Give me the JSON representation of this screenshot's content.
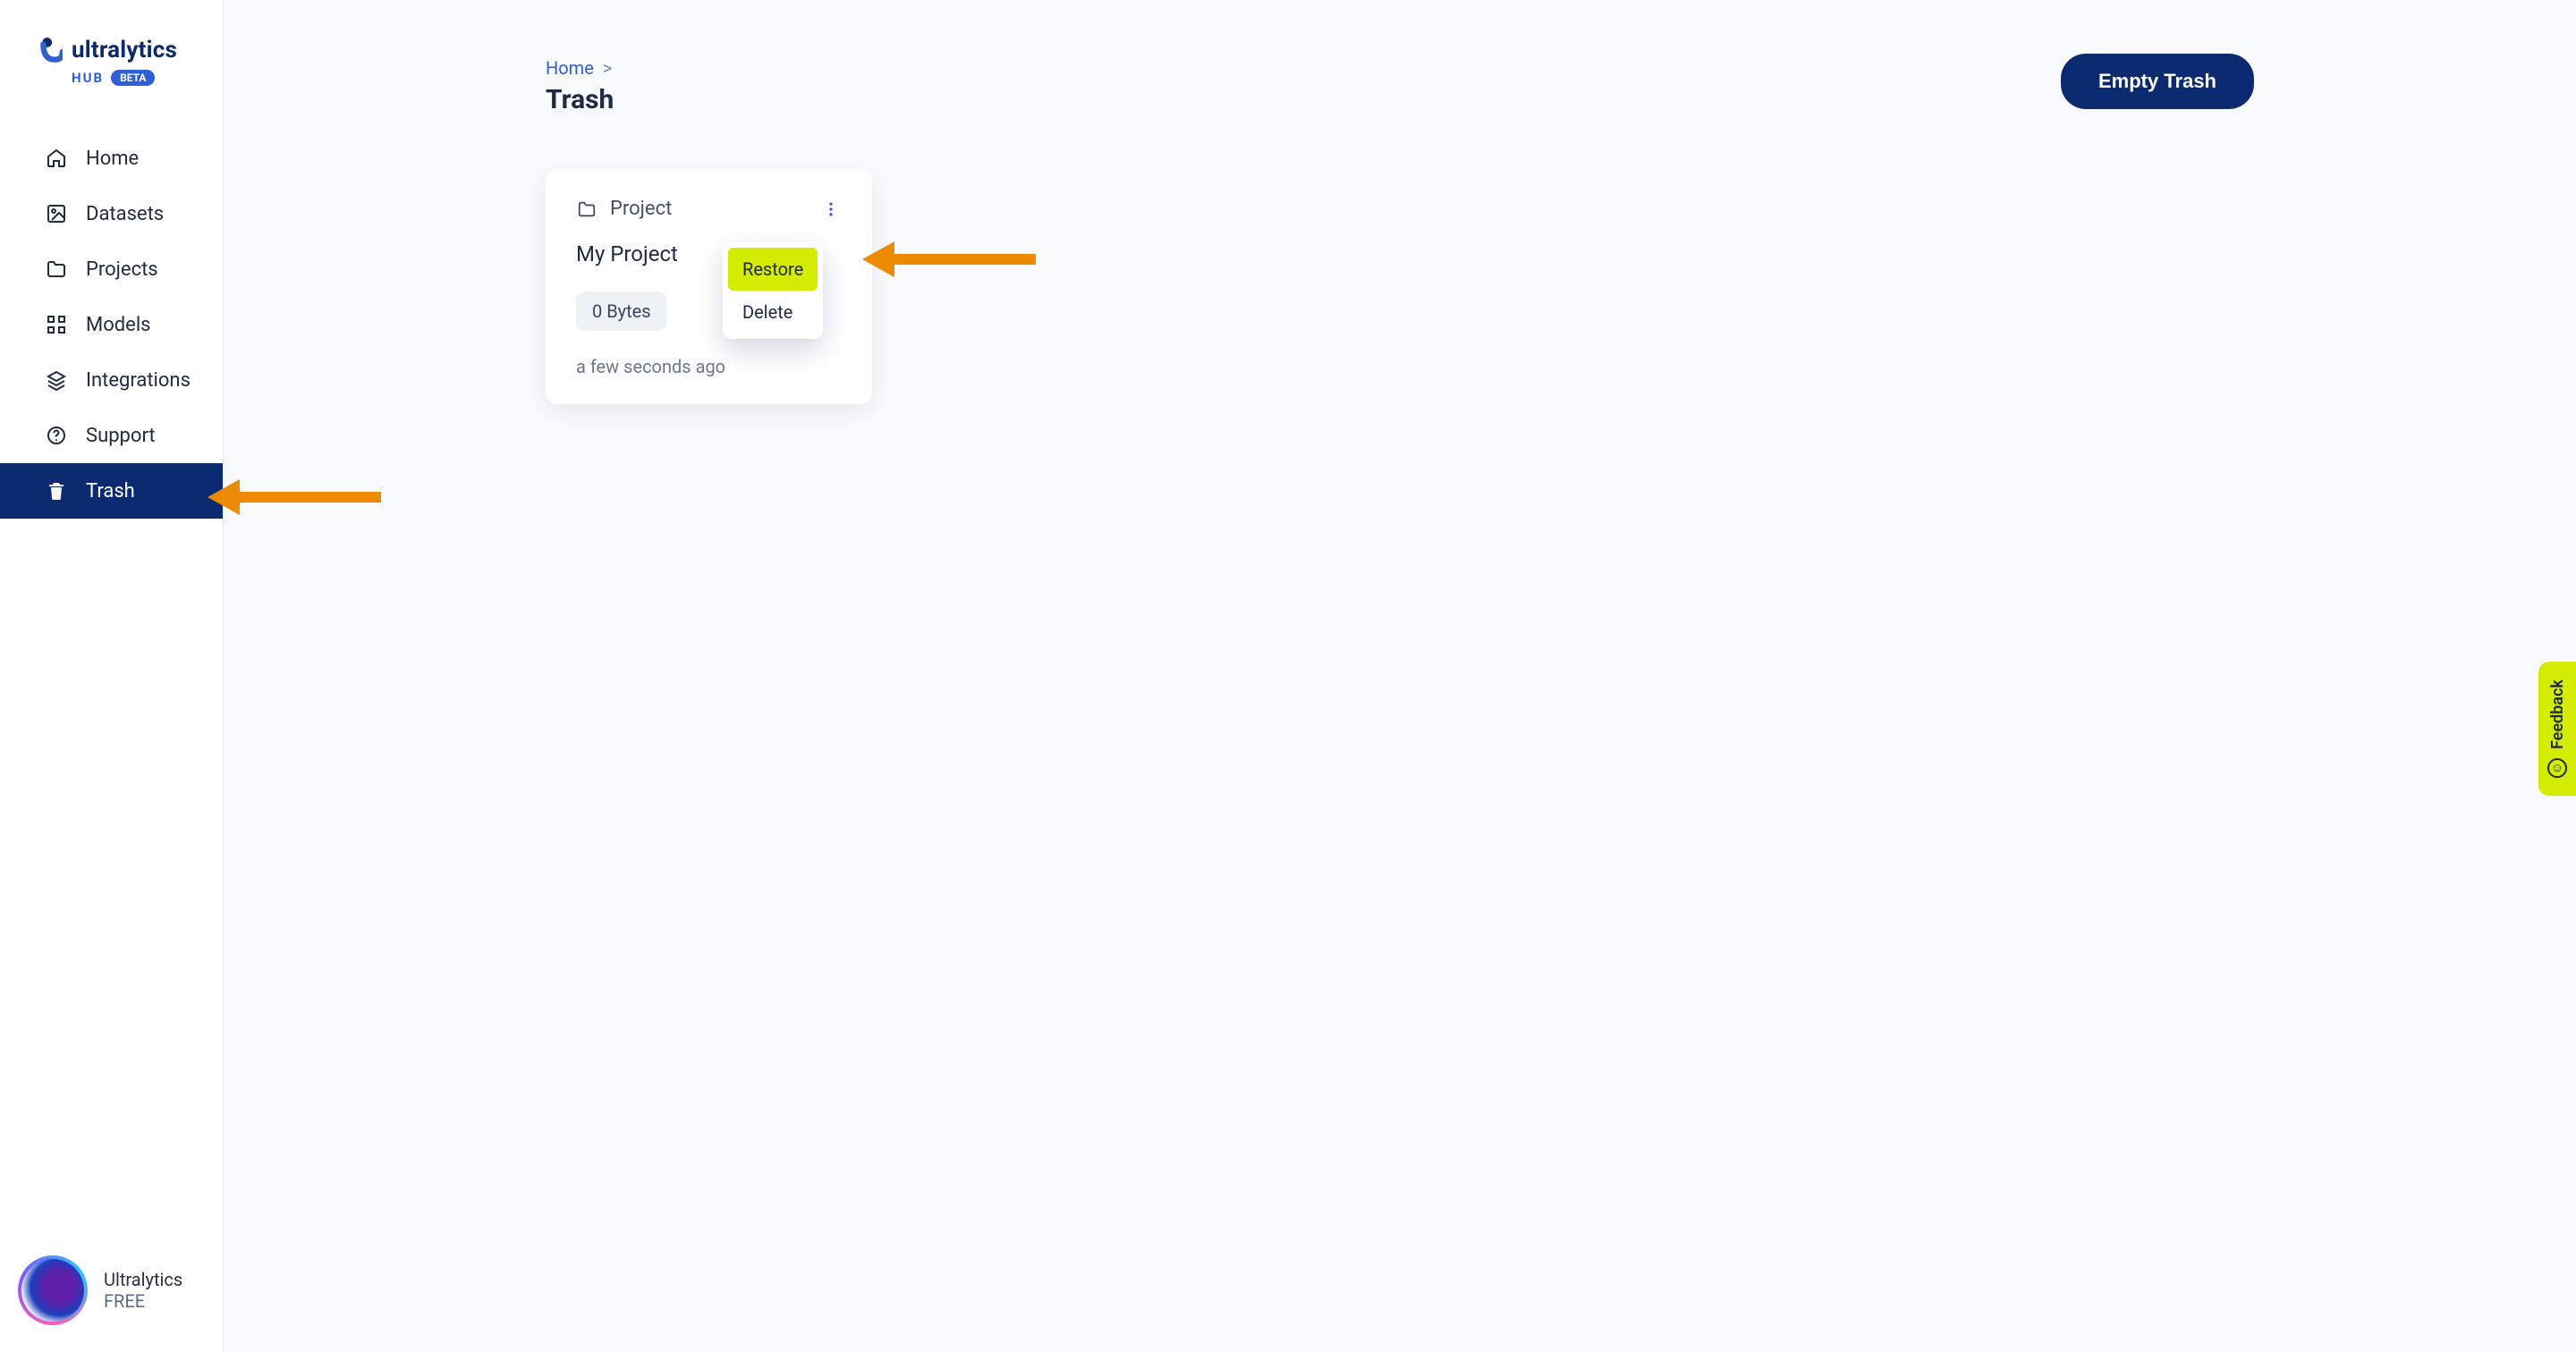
{
  "brand": {
    "name": "ultralytics",
    "sub": "HUB",
    "badge": "BETA"
  },
  "sidebar": {
    "items": [
      {
        "label": "Home",
        "icon": "home-icon"
      },
      {
        "label": "Datasets",
        "icon": "image-icon"
      },
      {
        "label": "Projects",
        "icon": "folder-icon"
      },
      {
        "label": "Models",
        "icon": "model-icon"
      },
      {
        "label": "Integrations",
        "icon": "layers-icon"
      },
      {
        "label": "Support",
        "icon": "help-icon"
      },
      {
        "label": "Trash",
        "icon": "trash-icon",
        "active": true
      }
    ],
    "account": {
      "name": "Ultralytics",
      "plan": "FREE"
    }
  },
  "breadcrumb": {
    "root": "Home",
    "sep": ">"
  },
  "page": {
    "title": "Trash",
    "empty_btn": "Empty Trash"
  },
  "card": {
    "type_label": "Project",
    "title": "My Project",
    "size": "0 Bytes",
    "time": "a few seconds ago",
    "menu": {
      "restore": "Restore",
      "delete": "Delete"
    }
  },
  "feedback": {
    "label": "Feedback"
  }
}
